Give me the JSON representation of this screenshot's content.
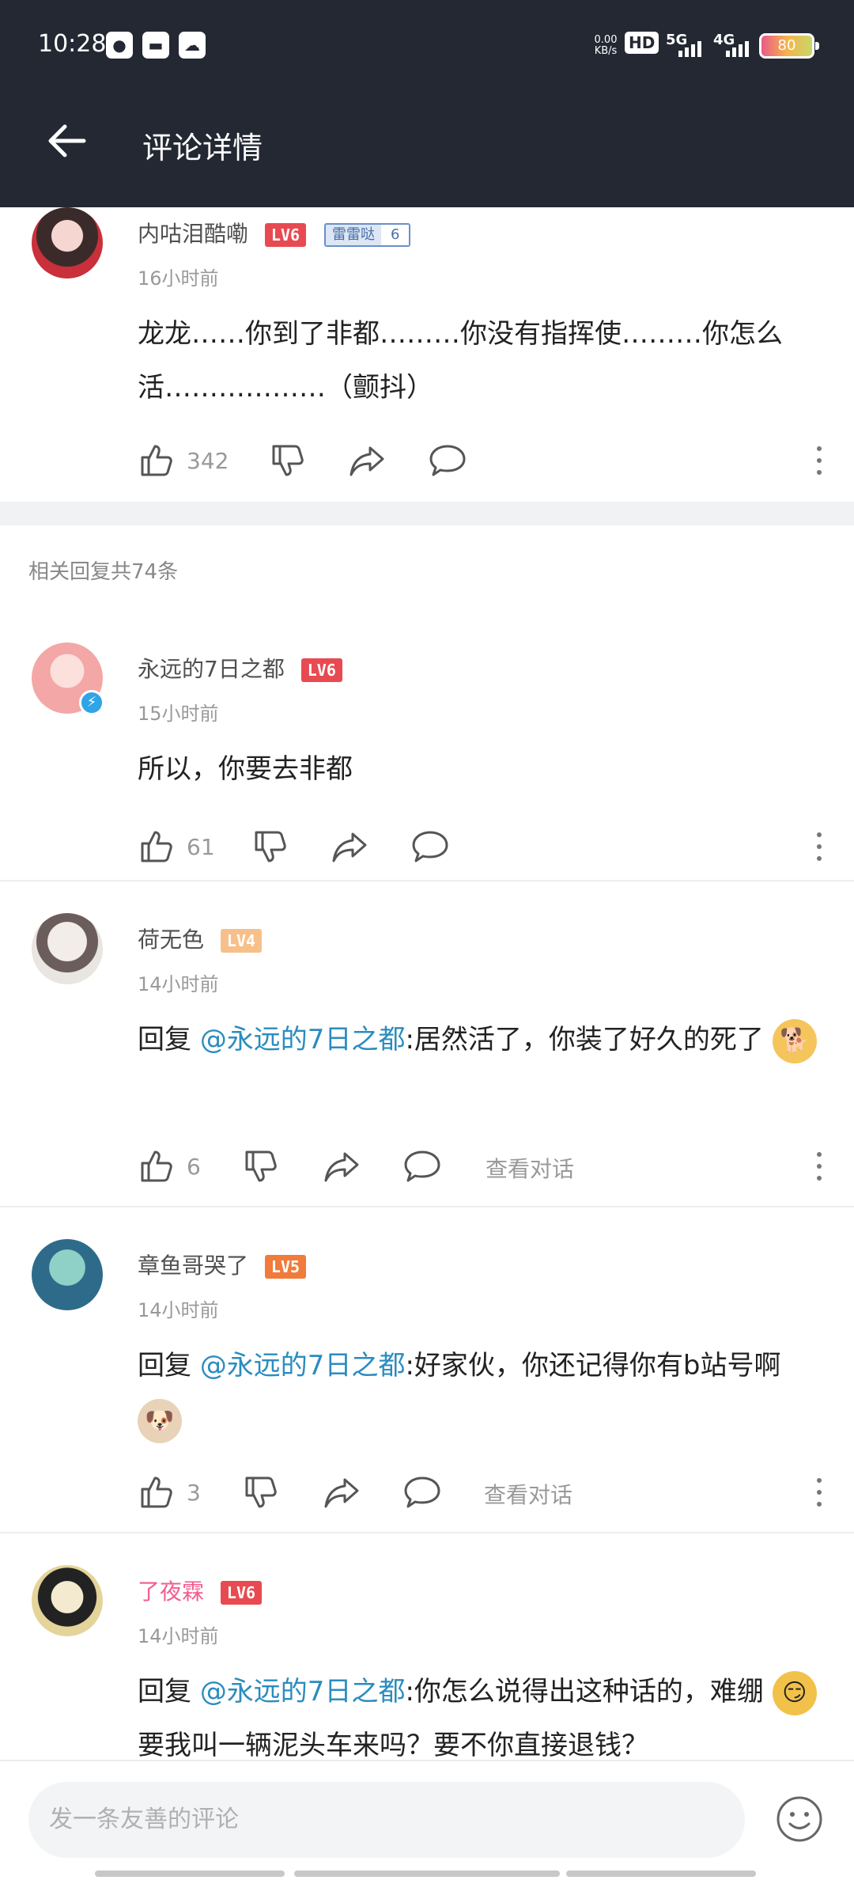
{
  "status_bar": {
    "time": "10:28",
    "speed_value": "0.00",
    "speed_unit": "KB/s",
    "hd": "HD",
    "net1": "5G",
    "net2": "4G",
    "battery": "80"
  },
  "header": {
    "title": "评论详情"
  },
  "main_comment": {
    "username": "内咕泪酷嘞",
    "level": "LV6",
    "fan_badge_name": "雷雷哒",
    "fan_badge_level": "6",
    "time": "16小时前",
    "text": "龙龙……你到了非都………你没有指挥使………你怎么活………………（颤抖）",
    "likes": "342"
  },
  "replies_count": "相关回复共74条",
  "replies": [
    {
      "username": "永远的7日之都",
      "level": "LV6",
      "time": "15小时前",
      "text": "所以，你要去非都",
      "likes": "61"
    },
    {
      "username": "荷无色",
      "level": "LV4",
      "time": "14小时前",
      "prefix": "回复",
      "mention": "@永远的7日之都",
      "text": ":居然活了，你装了好久的死了",
      "likes": "6",
      "view_conversation": "查看对话",
      "emoji": "doge-emoji"
    },
    {
      "username": "章鱼哥哭了",
      "level": "LV5",
      "time": "14小时前",
      "prefix": "回复",
      "mention": "@永远的7日之都",
      "text": ":好家伙，你还记得你有b站号啊",
      "likes": "3",
      "view_conversation": "查看对话",
      "emoji": "dog-face-emoji"
    },
    {
      "username": "了夜霖",
      "level": "LV6",
      "time": "14小时前",
      "prefix": "回复",
      "mention": "@永远的7日之都",
      "text": ":你怎么说得出这种话的，难绷",
      "text2": "要我叫一辆泥头车来吗？要不你直接退钱？",
      "emoji": "smirk-emoji"
    }
  ],
  "composer": {
    "placeholder": "发一条友善的评论",
    "emoji_button": "smile-icon"
  },
  "colors": {
    "header_bg": "#232833",
    "lv6": "#e84a52",
    "lv5": "#f07b3b",
    "lv4": "#f7c08a",
    "mention": "#2b8cbf",
    "vip_pink": "#f25d8e"
  }
}
